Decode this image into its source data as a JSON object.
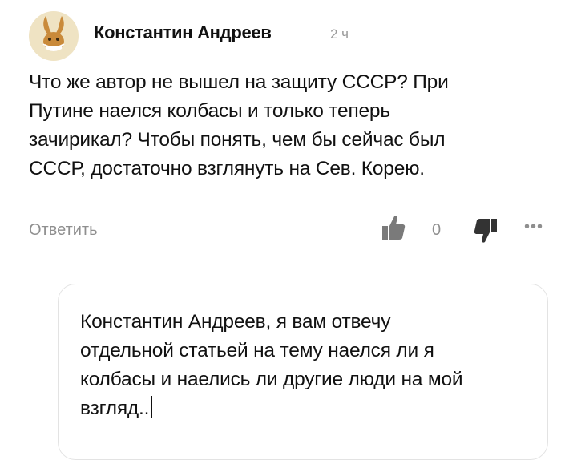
{
  "comment": {
    "author": "Константин Андреев",
    "time": "2 ч",
    "text": "Что же автор не вышел на защиту СССР? При\nПутине наелся колбасы и только теперь\nзачирикал? Чтобы понять, чем бы сейчас был\nСССР, достаточно взглянуть на Сев. Корею.",
    "reply_label": "Ответить",
    "like_count": "0",
    "more_label": "•••"
  },
  "reply_input": {
    "value": "Константин Андреев, я вам отвечу\nотдельной статьей на тему наелся ли я\nколбасы и наелись ли другие люди на мой\nвзгляд.."
  },
  "colors": {
    "muted": "#8f8f8f",
    "avatar_bg": "#efe3c3",
    "avatar_figure": "#c98a3a"
  }
}
